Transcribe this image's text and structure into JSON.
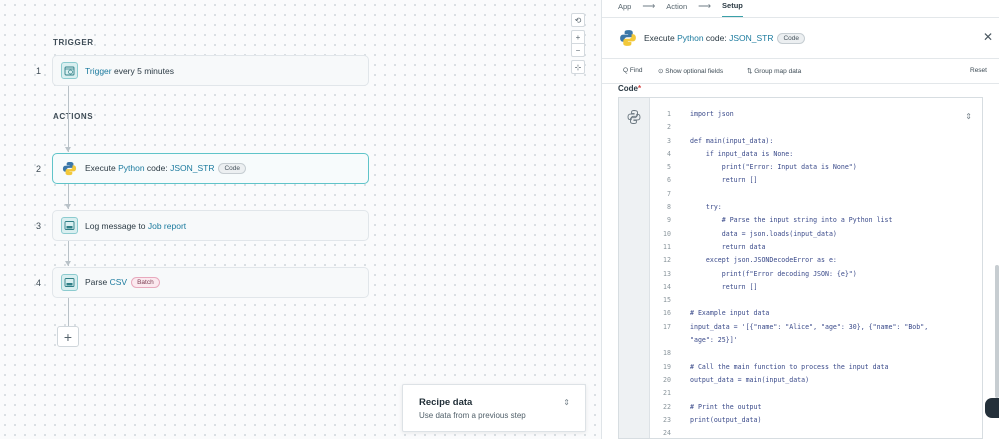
{
  "colors": {
    "accent": "#3aa0a8",
    "link": "#1b7a9e",
    "code_keyword": "#3a4a8a"
  },
  "canvas": {
    "trigger_label": "TRIGGER",
    "actions_label": "ACTIONS",
    "steps": [
      {
        "num": "1",
        "parts": [
          {
            "t": "Trigger",
            "hl": true
          },
          {
            "t": " every 5 minutes",
            "hl": false
          }
        ],
        "icon": "clock-icon",
        "pill": null
      },
      {
        "num": "2",
        "parts": [
          {
            "t": "Execute ",
            "hl": false
          },
          {
            "t": "Python",
            "hl": true
          },
          {
            "t": " code: ",
            "hl": false
          },
          {
            "t": "JSON_STR",
            "hl": true
          }
        ],
        "icon": "python-icon",
        "pill": {
          "label": "Code",
          "style": "gray"
        }
      },
      {
        "num": "3",
        "parts": [
          {
            "t": "Log message",
            "hl": false
          },
          {
            "t": " to ",
            "hl": false
          },
          {
            "t": "Job report",
            "hl": true
          }
        ],
        "icon": "log-icon",
        "pill": null
      },
      {
        "num": "4",
        "parts": [
          {
            "t": "Parse ",
            "hl": false
          },
          {
            "t": "CSV",
            "hl": true
          }
        ],
        "icon": "csv-icon",
        "pill": {
          "label": "Batch",
          "style": "pink"
        }
      }
    ],
    "add_button": "+",
    "zoom": {
      "reset": "⟲",
      "in": "+",
      "out": "−",
      "fit": "⊹"
    },
    "recipe_card": {
      "title": "Recipe data",
      "subtitle": "Use data from a previous step",
      "toggle": "⇕"
    }
  },
  "panel": {
    "breadcrumbs": [
      {
        "label": "App",
        "active": false
      },
      {
        "label": "Action",
        "active": false
      },
      {
        "label": "Setup",
        "active": true
      }
    ],
    "breadcrumb_sep": "⟶",
    "title_parts": [
      {
        "t": "Execute ",
        "hl": false
      },
      {
        "t": "Python",
        "hl": true
      },
      {
        "t": " code: ",
        "hl": false
      },
      {
        "t": "JSON_STR",
        "hl": true
      }
    ],
    "title_pill": "Code",
    "close": "✕",
    "toolbar": {
      "find": "Q Find",
      "optional": "⊙ Show optional fields",
      "group": "⇅ Group map data",
      "reset": "Reset"
    },
    "code_label": "Code",
    "code_required": "*",
    "editor_toggle": "⇕",
    "code_lines": [
      "import json",
      "",
      "def main(input_data):",
      "    if input_data is None:",
      "        print(\"Error: Input data is None\")",
      "        return []",
      "",
      "    try:",
      "        # Parse the input string into a Python list",
      "        data = json.loads(input_data)",
      "        return data",
      "    except json.JSONDecodeError as e:",
      "        print(f\"Error decoding JSON: {e}\")",
      "        return []",
      "",
      "# Example input data",
      "input_data = '[{\"name\": \"Alice\", \"age\": 30}, {\"name\": \"Bob\",",
      "\"age\": 25}]'",
      "",
      "# Call the main function to process the input data",
      "output_data = main(input_data)",
      "",
      "# Print the output",
      "print(output_data)",
      ""
    ],
    "line_numbers": [
      "1",
      "2",
      "3",
      "4",
      "5",
      "6",
      "7",
      "8",
      "9",
      "10",
      "11",
      "12",
      "13",
      "14",
      "15",
      "16",
      "17",
      "",
      "18",
      "19",
      "20",
      "21",
      "22",
      "23",
      "24"
    ]
  }
}
